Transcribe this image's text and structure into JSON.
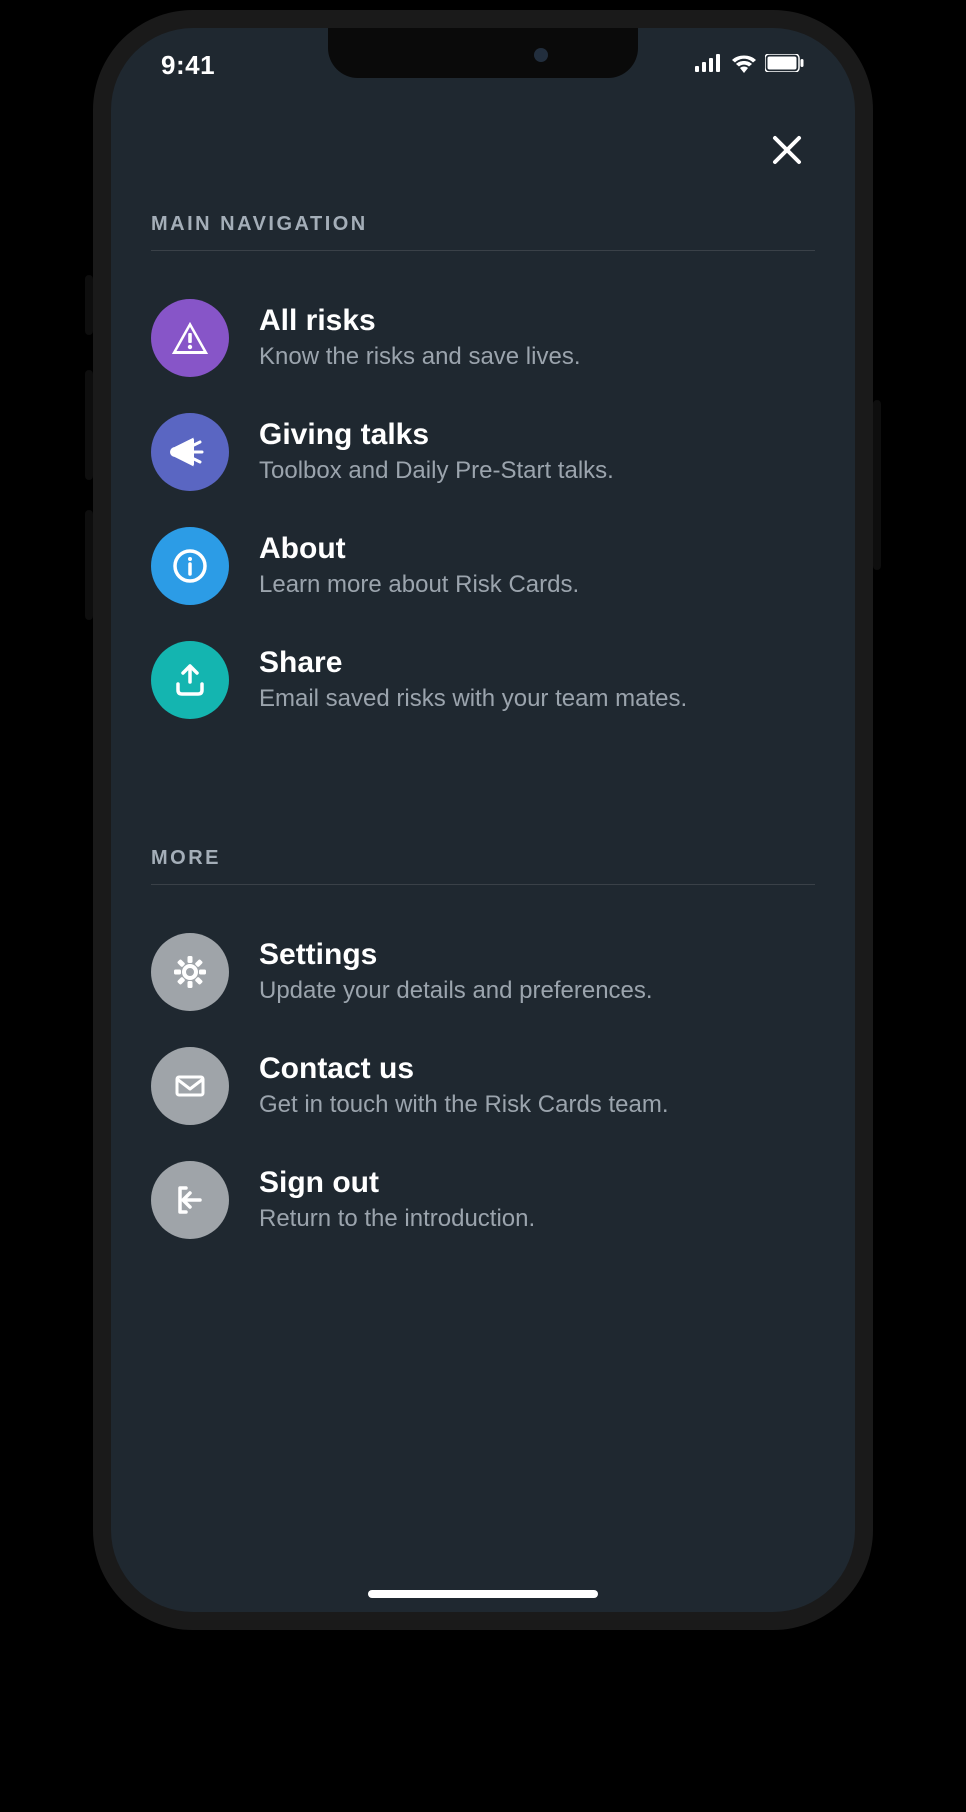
{
  "status": {
    "time": "9:41"
  },
  "sections": {
    "main": {
      "header": "MAIN NAVIGATION"
    },
    "more": {
      "header": "MORE"
    }
  },
  "nav": {
    "risks": {
      "title": "All risks",
      "sub": "Know the risks and save lives."
    },
    "talks": {
      "title": "Giving talks",
      "sub": "Toolbox and Daily Pre-Start talks."
    },
    "about": {
      "title": "About",
      "sub": "Learn more about Risk Cards."
    },
    "share": {
      "title": "Share",
      "sub": "Email saved risks with your team mates."
    },
    "settings": {
      "title": "Settings",
      "sub": "Update your details and preferences."
    },
    "contact": {
      "title": "Contact us",
      "sub": "Get in touch with the Risk Cards team."
    },
    "signout": {
      "title": "Sign out",
      "sub": "Return to the introduction."
    }
  }
}
